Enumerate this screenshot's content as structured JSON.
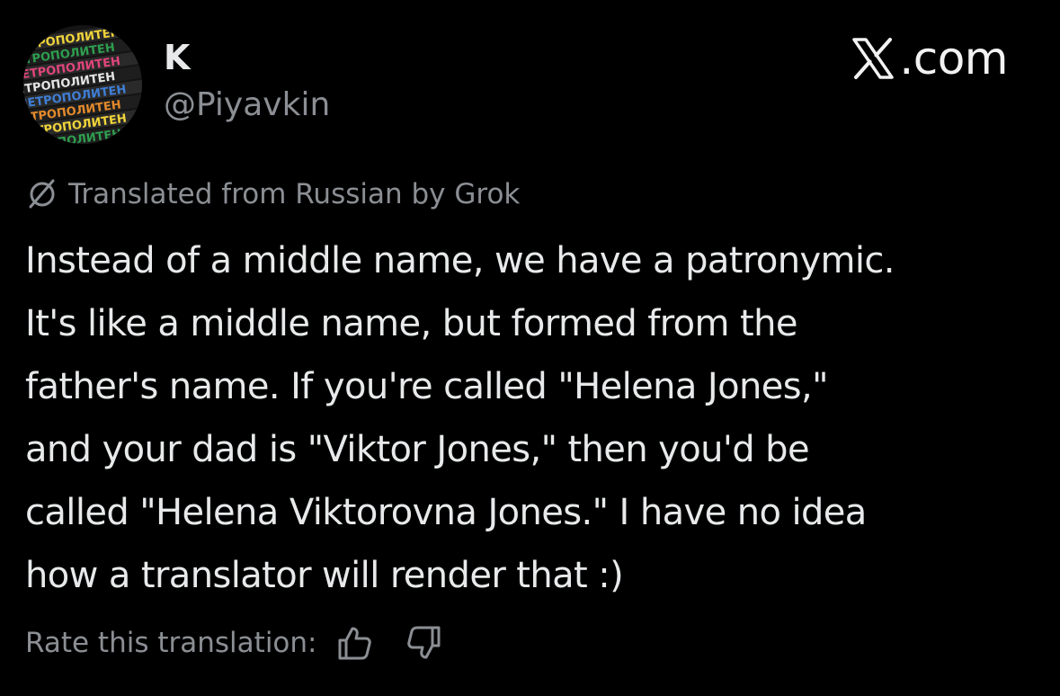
{
  "author": {
    "display_name": "K",
    "handle": "@Piyavkin",
    "avatar_text": "ЧЕТРОПОЛИТЕН"
  },
  "source": {
    "domain_suffix": ".com"
  },
  "translation": {
    "notice": "Translated from Russian by Grok"
  },
  "tweet": {
    "text": "Instead of a middle name, we have a patronymic.\nIt's like a middle name, but formed from the\nfather's name. If you're called \"Helena Jones,\"\nand your dad is \"Viktor Jones,\" then you'd be\ncalled \"Helena Viktorovna Jones.\" I have no idea\nhow a translator will render that :)"
  },
  "rating": {
    "label": "Rate this translation:"
  },
  "icons": {
    "translate": "globe-slash-icon",
    "thumbs_up": "thumbs-up-icon",
    "thumbs_down": "thumbs-down-icon",
    "logo": "x-logo-icon"
  },
  "colors": {
    "background": "#000000",
    "primary_text": "#e7e9ea",
    "secondary_text": "#8b8f94"
  }
}
